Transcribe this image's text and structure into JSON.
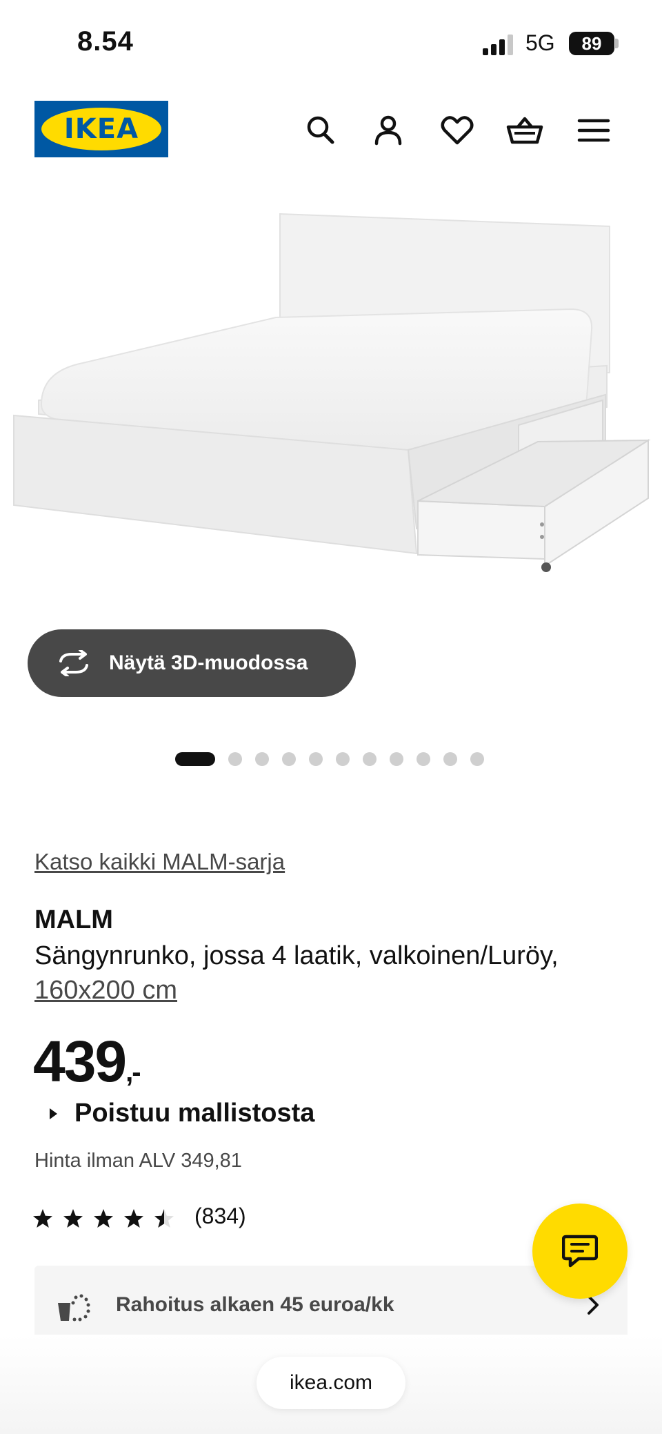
{
  "status_bar": {
    "time": "8.54",
    "network": "5G",
    "battery": "89"
  },
  "header": {
    "logo_text": "IKEA",
    "icons": [
      "search-icon",
      "account-icon",
      "heart-icon",
      "basket-icon",
      "menu-icon"
    ]
  },
  "gallery": {
    "view_3d_label": "Näytä 3D-muodossa",
    "dots_total": 11,
    "active_dot": 1
  },
  "product": {
    "series_link": "Katso kaikki MALM-sarja",
    "name": "MALM",
    "description": "Sängynrunko, jossa 4 laatik, valkoinen/Luröy,",
    "size": "160x200 cm",
    "price": "439",
    "price_suffix": ",-",
    "status": "Poistuu mallistosta",
    "price_excl_vat": "Hinta ilman ALV 349,81",
    "rating": 4.5,
    "review_count": "(834)"
  },
  "financing": {
    "label": "Rahoitus alkaen 45 euroa/kk"
  },
  "browser": {
    "url": "ikea.com"
  },
  "colors": {
    "ikea_blue": "#0058a3",
    "ikea_yellow": "#ffdb00",
    "button_dark": "#484848"
  }
}
